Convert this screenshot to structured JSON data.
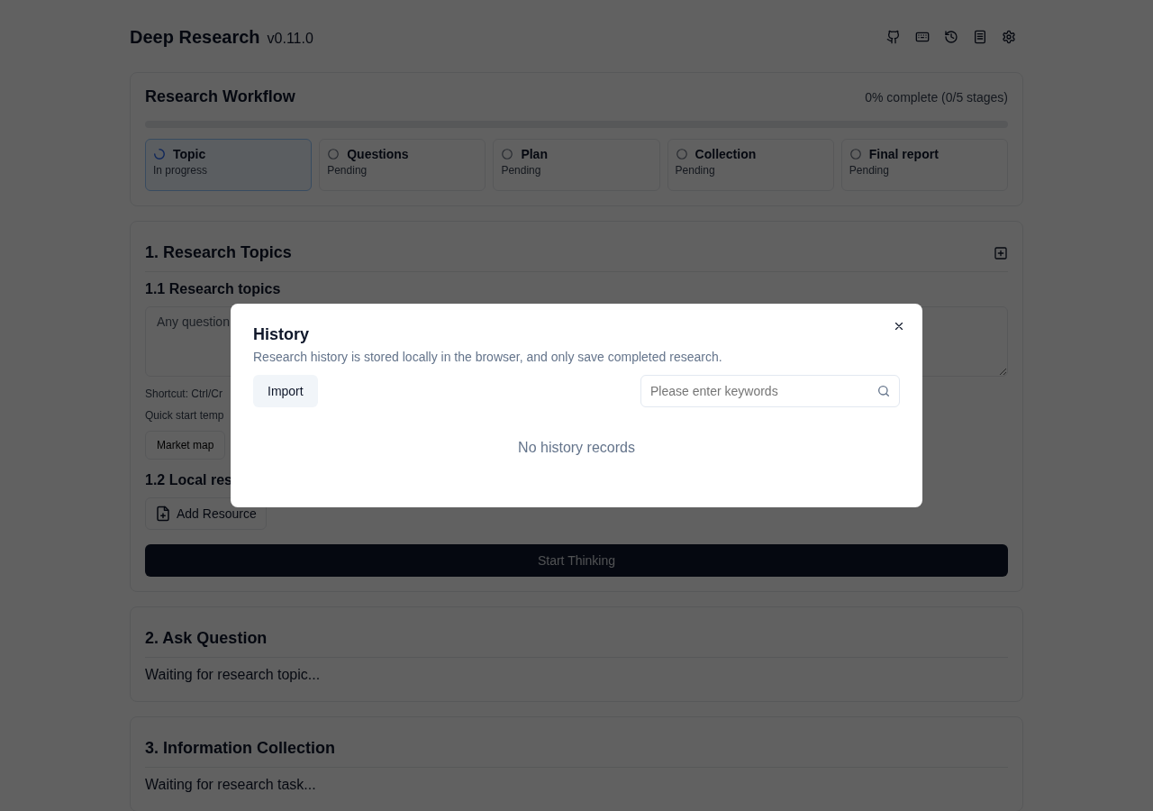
{
  "header": {
    "title": "Deep Research",
    "version": "v0.11.0",
    "icons": [
      {
        "kind": "github"
      },
      {
        "kind": "keyboard"
      },
      {
        "kind": "history"
      },
      {
        "kind": "document"
      },
      {
        "kind": "settings"
      }
    ]
  },
  "workflow": {
    "title": "Research Workflow",
    "summary": "0% complete (0/5 stages)",
    "level": 0,
    "stages": [
      {
        "label": "Topic",
        "status": "In progress",
        "kind": "active"
      },
      {
        "label": "Questions",
        "status": "Pending",
        "kind": "pending"
      },
      {
        "label": "Plan",
        "status": "Pending",
        "kind": "pending"
      },
      {
        "label": "Collection",
        "status": "Pending",
        "kind": "pending"
      },
      {
        "label": "Final report",
        "status": "Pending",
        "kind": "pending"
      }
    ]
  },
  "topics": {
    "title": "1. Research Topics",
    "subtitle": "1.1 Research topics",
    "placeholder": "Any question",
    "shortcut": "Shortcut: Ctrl/Cr",
    "templates_label": "Quick start temp",
    "templates": [
      "Market map"
    ],
    "resources_title": "1.2 Local res",
    "add_resource": "Add Resource",
    "start": "Start Thinking"
  },
  "sections": [
    {
      "title": "2. Ask Question",
      "status": "Waiting for research topic..."
    },
    {
      "title": "3. Information Collection",
      "status": "Waiting for research task..."
    }
  ],
  "dialog": {
    "title": "History",
    "description": "Research history is stored locally in the browser, and only save completed research.",
    "import": "Import",
    "search": {
      "placeholder": "Please enter keywords"
    },
    "empty": "No history records"
  }
}
